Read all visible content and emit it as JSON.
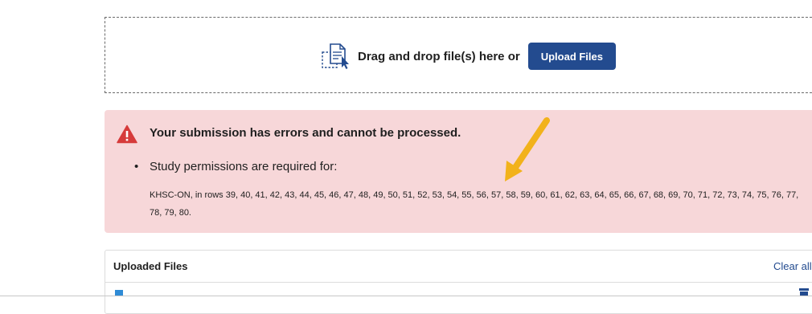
{
  "dropzone": {
    "text": "Drag and drop file(s) here or",
    "upload_button": "Upload Files",
    "icon": "file-upload-icon"
  },
  "error": {
    "icon": "warning-triangle-icon",
    "title": "Your submission has errors and cannot be processed.",
    "item_label": "Study permissions are required for:",
    "detail": "KHSC-ON, in rows 39, 40, 41, 42, 43, 44, 45, 46, 47, 48, 49, 50, 51, 52, 53, 54, 55, 56, 57, 58, 59, 60, 61, 62, 63, 64, 65, 66, 67, 68, 69, 70, 71, 72, 73, 74, 75, 76, 77, 78, 79, 80.",
    "background_color": "#f7d7d9",
    "icon_color": "#d63b3b"
  },
  "uploaded_files": {
    "title": "Uploaded Files",
    "clear_all": "Clear all"
  },
  "colors": {
    "accent": "#234b8f",
    "annotation_arrow": "#f2b21b"
  }
}
